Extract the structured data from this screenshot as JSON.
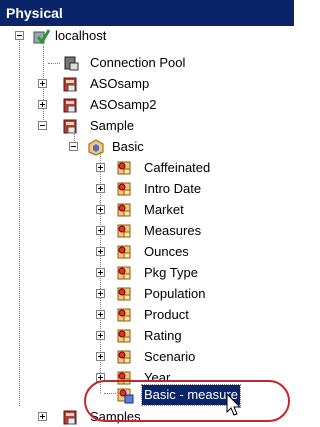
{
  "panel": {
    "title": "Physical"
  },
  "tree": {
    "root": "localhost",
    "connection_pool": "Connection Pool",
    "asosamp": "ASOsamp",
    "asosamp2": "ASOsamp2",
    "sample": "Sample",
    "basic": "Basic",
    "dimensions": [
      "Caffeinated",
      "Intro Date",
      "Market",
      "Measures",
      "Ounces",
      "Pkg Type",
      "Population",
      "Product",
      "Rating",
      "Scenario",
      "Year"
    ],
    "selected": "Basic - measure",
    "samples": "Samples"
  },
  "colors": {
    "titlebar": "#0a246a",
    "selection": "#0a246a",
    "highlight": "#c0282d"
  }
}
